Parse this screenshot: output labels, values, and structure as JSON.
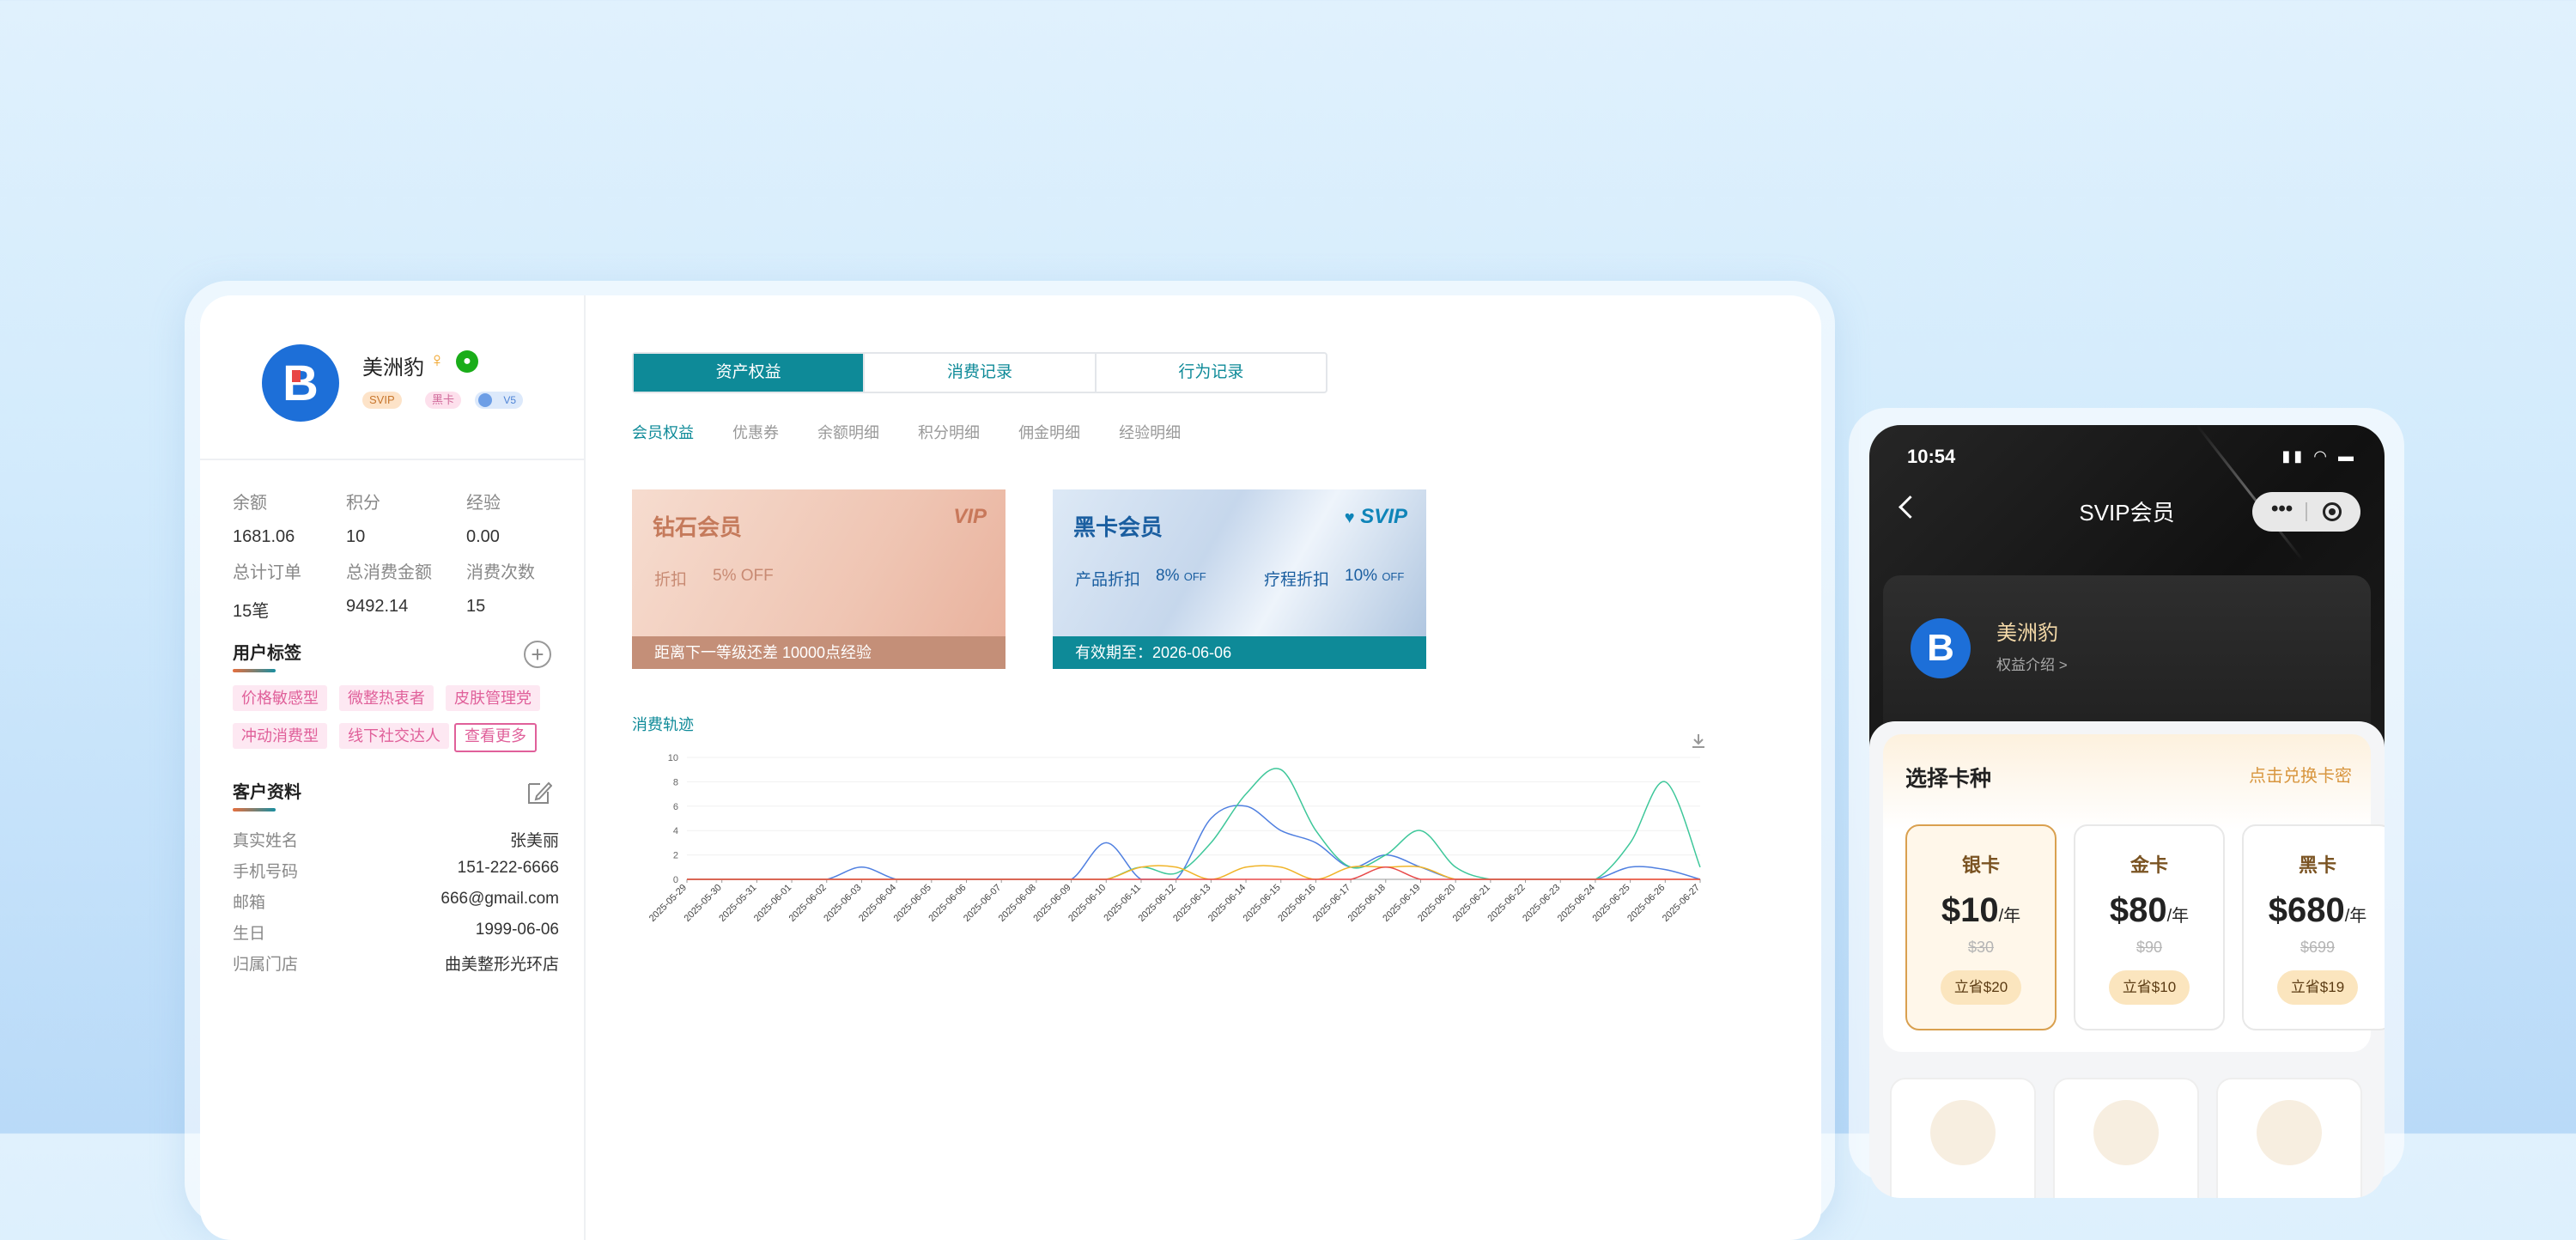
{
  "desktop": {
    "user": {
      "avatar_letter": "B",
      "name": "美洲豹",
      "gender_symbol": "♀",
      "wechat_icon": "wechat-icon",
      "badges": [
        "SVIP",
        "黑卡",
        "V5"
      ]
    },
    "stats": [
      {
        "label": "余额",
        "value": "1681.06"
      },
      {
        "label": "积分",
        "value": "10"
      },
      {
        "label": "经验",
        "value": "0.00"
      },
      {
        "label": "总计订单",
        "value": "15笔"
      },
      {
        "label": "总消费金额",
        "value": "9492.14"
      },
      {
        "label": "消费次数",
        "value": "15"
      }
    ],
    "tags_title": "用户标签",
    "tags": [
      "价格敏感型",
      "微整热衷者",
      "皮肤管理党",
      "冲动消费型",
      "线下社交达人"
    ],
    "tags_more": "查看更多",
    "profile_title": "客户资料",
    "profile": [
      {
        "label": "真实姓名",
        "value": "张美丽"
      },
      {
        "label": "手机号码",
        "value": "151-222-6666"
      },
      {
        "label": "邮箱",
        "value": "666@gmail.com"
      },
      {
        "label": "生日",
        "value": "1999-06-06"
      },
      {
        "label": "归属门店",
        "value": "曲美整形光环店"
      }
    ],
    "tabs": [
      "资产权益",
      "消费记录",
      "行为记录"
    ],
    "active_tab": "资产权益",
    "subtabs": [
      "会员权益",
      "优惠券",
      "余额明细",
      "积分明细",
      "佣金明细",
      "经验明细"
    ],
    "cards": [
      {
        "title": "钻石会员",
        "logo": "VIP",
        "line1_label": "折扣",
        "line1_value": "5% OFF",
        "footer": "距离下一等级还差 10000点经验"
      },
      {
        "title": "黑卡会员",
        "logo": "SVIP",
        "line1_label": "产品折扣",
        "line1_value": "8%",
        "line1_unit": "OFF",
        "line2_label": "疗程折扣",
        "line2_value": "10%",
        "line2_unit": "OFF",
        "footer": "有效期至：2026-06-06"
      }
    ],
    "chart_title": "消费轨迹"
  },
  "chart_data": {
    "type": "line",
    "x": [
      "2025-05-29",
      "2025-05-30",
      "2025-05-31",
      "2025-06-01",
      "2025-06-02",
      "2025-06-03",
      "2025-06-04",
      "2025-06-05",
      "2025-06-06",
      "2025-06-07",
      "2025-06-08",
      "2025-06-09",
      "2025-06-10",
      "2025-06-11",
      "2025-06-12",
      "2025-06-13",
      "2025-06-14",
      "2025-06-15",
      "2025-06-16",
      "2025-06-17",
      "2025-06-18",
      "2025-06-19",
      "2025-06-20",
      "2025-06-21",
      "2025-06-22",
      "2025-06-23",
      "2025-06-24",
      "2025-06-25",
      "2025-06-26",
      "2025-06-27"
    ],
    "ylim": [
      0,
      10
    ],
    "yticks": [
      0,
      2,
      4,
      6,
      8,
      10
    ],
    "series": [
      {
        "color": "#4f7fe0",
        "values": [
          0,
          0,
          0,
          0,
          0,
          1,
          0,
          0,
          0,
          0,
          0,
          0,
          3,
          0,
          0,
          5,
          6,
          4,
          3,
          1,
          2,
          1,
          0,
          0,
          0,
          0,
          0,
          1,
          0.8,
          0
        ]
      },
      {
        "color": "#3ec79a",
        "values": [
          0,
          0,
          0,
          0,
          0,
          0,
          0,
          0,
          0,
          0,
          0,
          0,
          0,
          1,
          0.5,
          3,
          7,
          9,
          4,
          1,
          2,
          4,
          1,
          0,
          0,
          0,
          0,
          3,
          8,
          1
        ]
      },
      {
        "color": "#f0b429",
        "values": [
          0,
          0,
          0,
          0,
          0,
          0,
          0,
          0,
          0,
          0,
          0,
          0,
          0,
          1,
          1,
          0,
          1,
          1,
          0,
          1,
          1,
          1,
          0,
          0,
          0,
          0,
          0,
          0,
          0,
          0
        ]
      },
      {
        "color": "#e84a4a",
        "values": [
          0,
          0,
          0,
          0,
          0,
          0,
          0,
          0,
          0,
          0,
          0,
          0,
          0,
          0,
          0,
          0,
          0,
          0,
          0,
          0,
          1,
          0,
          0,
          0,
          0,
          0,
          0,
          0,
          0,
          0
        ]
      }
    ]
  },
  "phone": {
    "time": "10:54",
    "status_icons": "signal-wifi-battery",
    "title": "SVIP会员",
    "user_name": "美洲豹",
    "user_avatar_letter": "B",
    "intro_link": "权益介绍 >",
    "select_title": "选择卡种",
    "redeem_link": "点击兑换卡密",
    "plans": [
      {
        "name": "银卡",
        "price": "$10",
        "unit": "/年",
        "original": "$30",
        "save": "立省$20",
        "selected": true
      },
      {
        "name": "金卡",
        "price": "$80",
        "unit": "/年",
        "original": "$90",
        "save": "立省$10",
        "selected": false
      },
      {
        "name": "黑卡",
        "price": "$680",
        "unit": "/年",
        "original": "$699",
        "save": "立省$19",
        "selected": false
      }
    ]
  }
}
